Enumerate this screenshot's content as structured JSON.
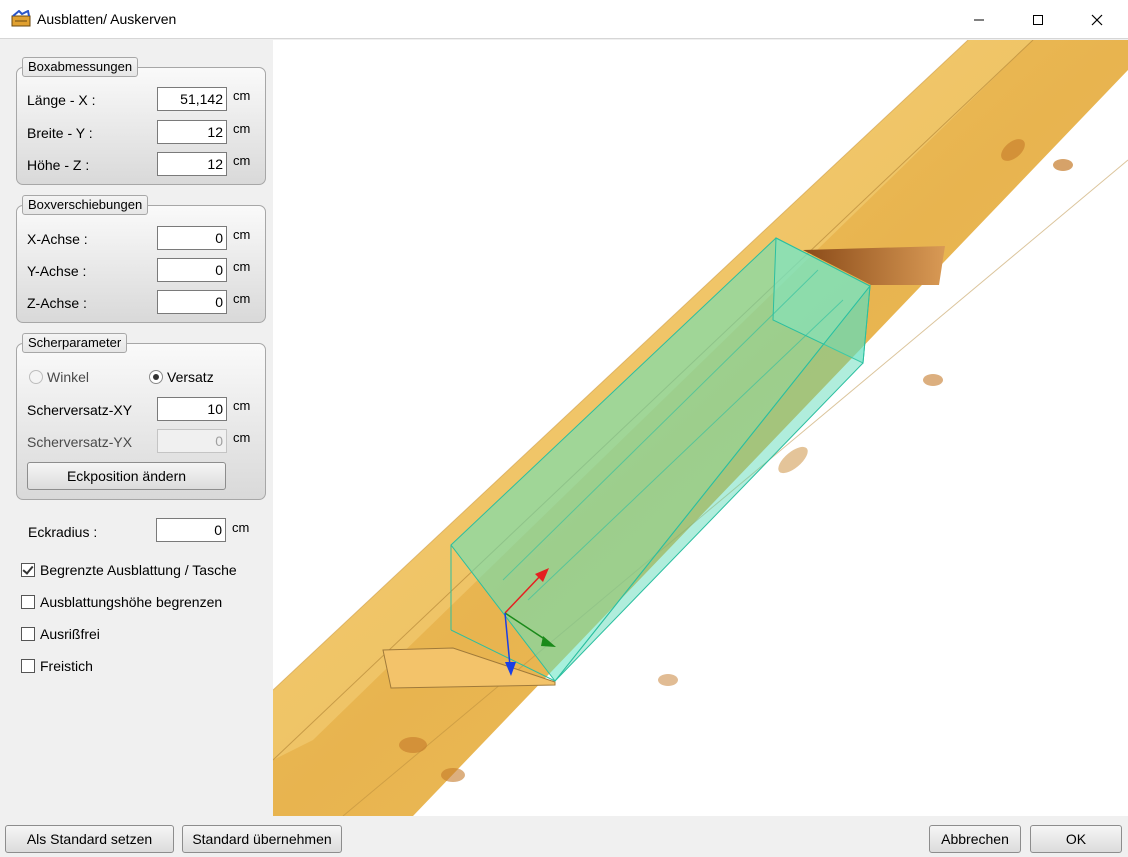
{
  "window": {
    "title": "Ausblatten/ Auskerven",
    "app_icon": "blue-wood-tool-icon",
    "controls": {
      "minimize": "minimize-icon",
      "maximize": "maximize-icon",
      "close": "close-icon"
    }
  },
  "boxabmessungen": {
    "legend": "Boxabmessungen",
    "rows": [
      {
        "label": "Länge - X :",
        "value": "51,142",
        "unit": "cm"
      },
      {
        "label": "Breite - Y :",
        "value": "12",
        "unit": "cm"
      },
      {
        "label": "Höhe - Z :",
        "value": "12",
        "unit": "cm"
      }
    ]
  },
  "boxverschiebungen": {
    "legend": "Boxverschiebungen",
    "rows": [
      {
        "label": "X-Achse :",
        "value": "0",
        "unit": "cm"
      },
      {
        "label": "Y-Achse :",
        "value": "0",
        "unit": "cm"
      },
      {
        "label": "Z-Achse :",
        "value": "0",
        "unit": "cm"
      }
    ]
  },
  "scherparameter": {
    "legend": "Scherparameter",
    "radio_winkel": "Winkel",
    "radio_versatz": "Versatz",
    "selected": "Versatz",
    "xy": {
      "label": "Scherversatz-XY",
      "value": "10",
      "unit": "cm"
    },
    "yx": {
      "label": "Scherversatz-YX",
      "value": "0",
      "unit": "cm"
    },
    "button": "Eckposition ändern"
  },
  "eckradius": {
    "label": "Eckradius :",
    "value": "0",
    "unit": "cm"
  },
  "options": [
    {
      "label": "Begrenzte Ausblattung / Tasche",
      "checked": true
    },
    {
      "label": "Ausblattungshöhe begrenzen",
      "checked": false
    },
    {
      "label": "Ausrißfrei",
      "checked": false
    },
    {
      "label": "Freistich",
      "checked": false
    }
  ],
  "buttons": {
    "set_default": "Als Standard setzen",
    "apply_default": "Standard übernehmen",
    "cancel": "Abbrechen",
    "ok": "OK"
  },
  "colors": {
    "wood": "#e8b44f",
    "wood_dark": "#c98a33",
    "box": "#5fe3c0",
    "axis_x": "#e52020",
    "axis_y": "#1a8a1a",
    "axis_z": "#1a3fe5"
  }
}
